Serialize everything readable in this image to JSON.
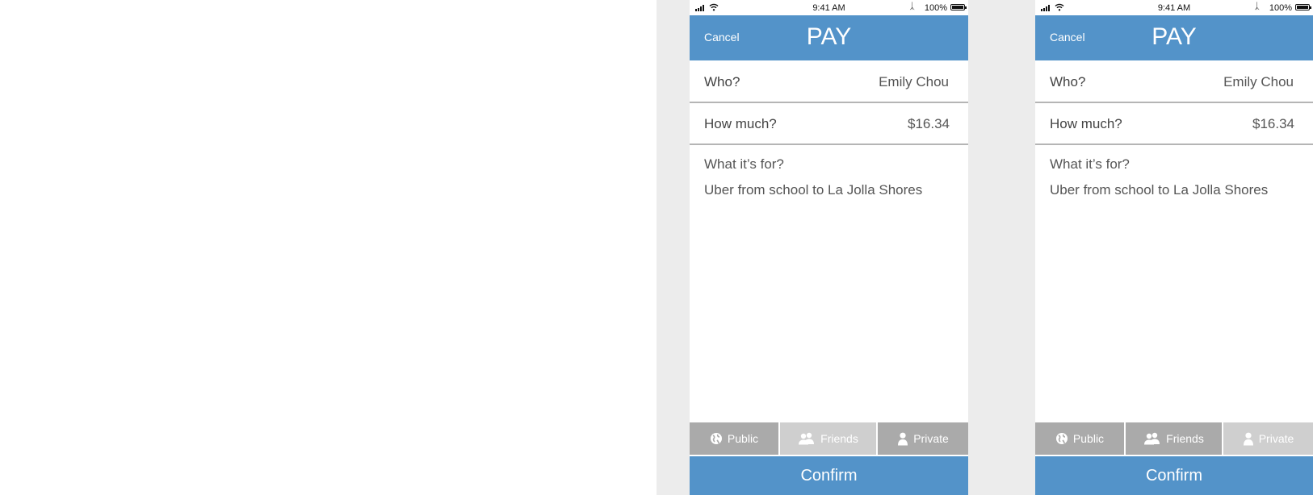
{
  "phones": [
    {
      "status": {
        "time": "9:41 AM",
        "battery": "100%"
      },
      "nav": {
        "cancel": "Cancel",
        "title": "PAY"
      },
      "who": {
        "label": "Who?",
        "value": "Emily Chou"
      },
      "amount": {
        "label": "How much?",
        "value": "$16.34"
      },
      "memo": {
        "label": "What it’s for?",
        "text": "Uber from school to La Jolla Shores"
      },
      "privacy": {
        "public": "Public",
        "friends": "Friends",
        "private": "Private",
        "selected": "friends"
      },
      "confirm": "Confirm"
    },
    {
      "status": {
        "time": "9:41 AM",
        "battery": "100%"
      },
      "nav": {
        "cancel": "Cancel",
        "title": "PAY"
      },
      "who": {
        "label": "Who?",
        "value": "Emily Chou"
      },
      "amount": {
        "label": "How much?",
        "value": "$16.34"
      },
      "memo": {
        "label": "What it’s for?",
        "text": "Uber from school to La Jolla Shores"
      },
      "privacy": {
        "public": "Public",
        "friends": "Friends",
        "private": "Private",
        "selected": "private"
      },
      "confirm": "Confirm"
    }
  ],
  "colors": {
    "accent": "#5393c9",
    "segment_active": "#aaaaaa",
    "segment_inactive": "#cfcfcf",
    "background_panel": "#ececec"
  },
  "icons": [
    "signal-icon",
    "wifi-icon",
    "bluetooth-icon",
    "battery-icon",
    "globe-icon",
    "friends-icon",
    "person-icon"
  ]
}
